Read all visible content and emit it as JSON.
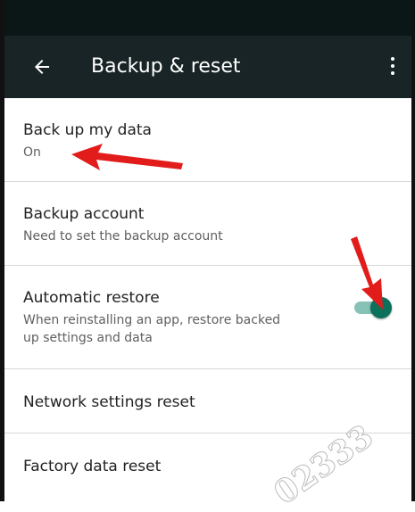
{
  "header": {
    "title": "Backup & reset",
    "back_icon": "arrow-back-icon",
    "menu_icon": "more-vert-icon"
  },
  "settings": {
    "back_up": {
      "title": "Back up my data",
      "summary": "On"
    },
    "backup_account": {
      "title": "Backup account",
      "summary": "Need to set the backup account"
    },
    "automatic_restore": {
      "title": "Automatic restore",
      "summary_line1": "When reinstalling an app, restore backed",
      "summary_line2": "up settings and data",
      "toggle_on": true
    },
    "network_reset": {
      "title": "Network settings reset"
    },
    "factory_reset": {
      "title": "Factory data reset"
    }
  },
  "annotations": {
    "arrow_color": "#e21b1b"
  },
  "watermark": {
    "text": "02333"
  },
  "colors": {
    "appbar": "#182425",
    "statusbar": "#0b1717",
    "accent": "#0c705a"
  }
}
